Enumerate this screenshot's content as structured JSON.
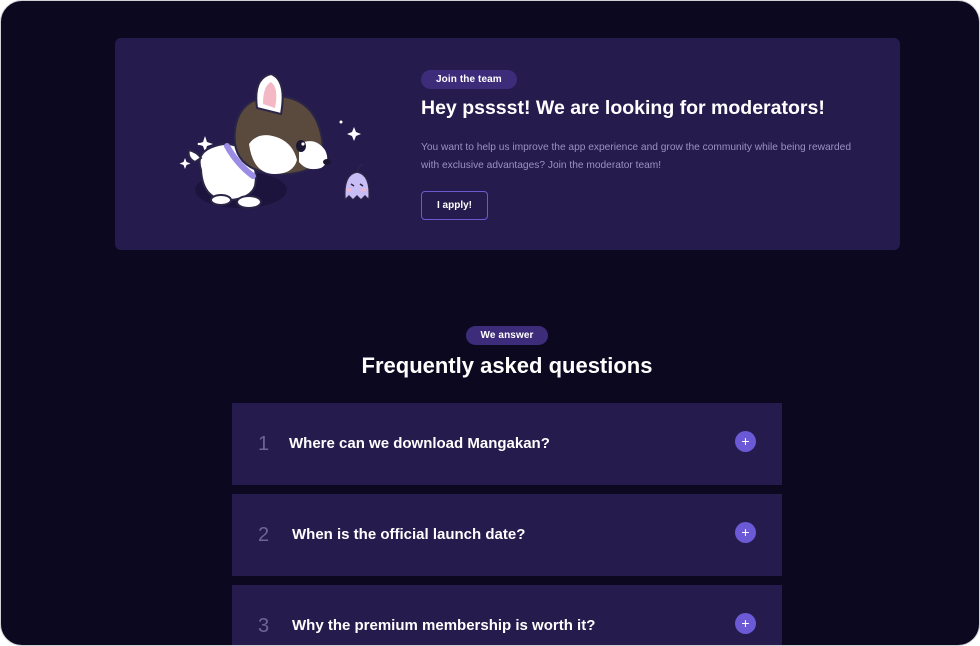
{
  "hero": {
    "badge": "Join the team",
    "title": "Hey psssst! We are looking for moderators!",
    "text": "You want to help us improve the app experience and grow the community while being rewarded with exclusive advantages? Join the moderator team!",
    "apply_label": "I apply!"
  },
  "faq": {
    "badge": "We answer",
    "title": "Frequently asked questions",
    "items": [
      {
        "number": "1",
        "question": "Where can we download Mangakan?"
      },
      {
        "number": "2",
        "question": "When is the official launch date?"
      },
      {
        "number": "3",
        "question": "Why the premium membership is worth it?"
      }
    ],
    "expand_symbol": "+"
  },
  "colors": {
    "page_background": "#0b0820",
    "card_background": "#261b4d",
    "badge_background": "#3d2c7a",
    "accent": "#6b5ad6",
    "muted_text": "#9a92c3"
  },
  "icons": [
    "dog-mascot-illustration",
    "ghost-mascot-icon",
    "sparkle-icon",
    "plus-icon"
  ]
}
